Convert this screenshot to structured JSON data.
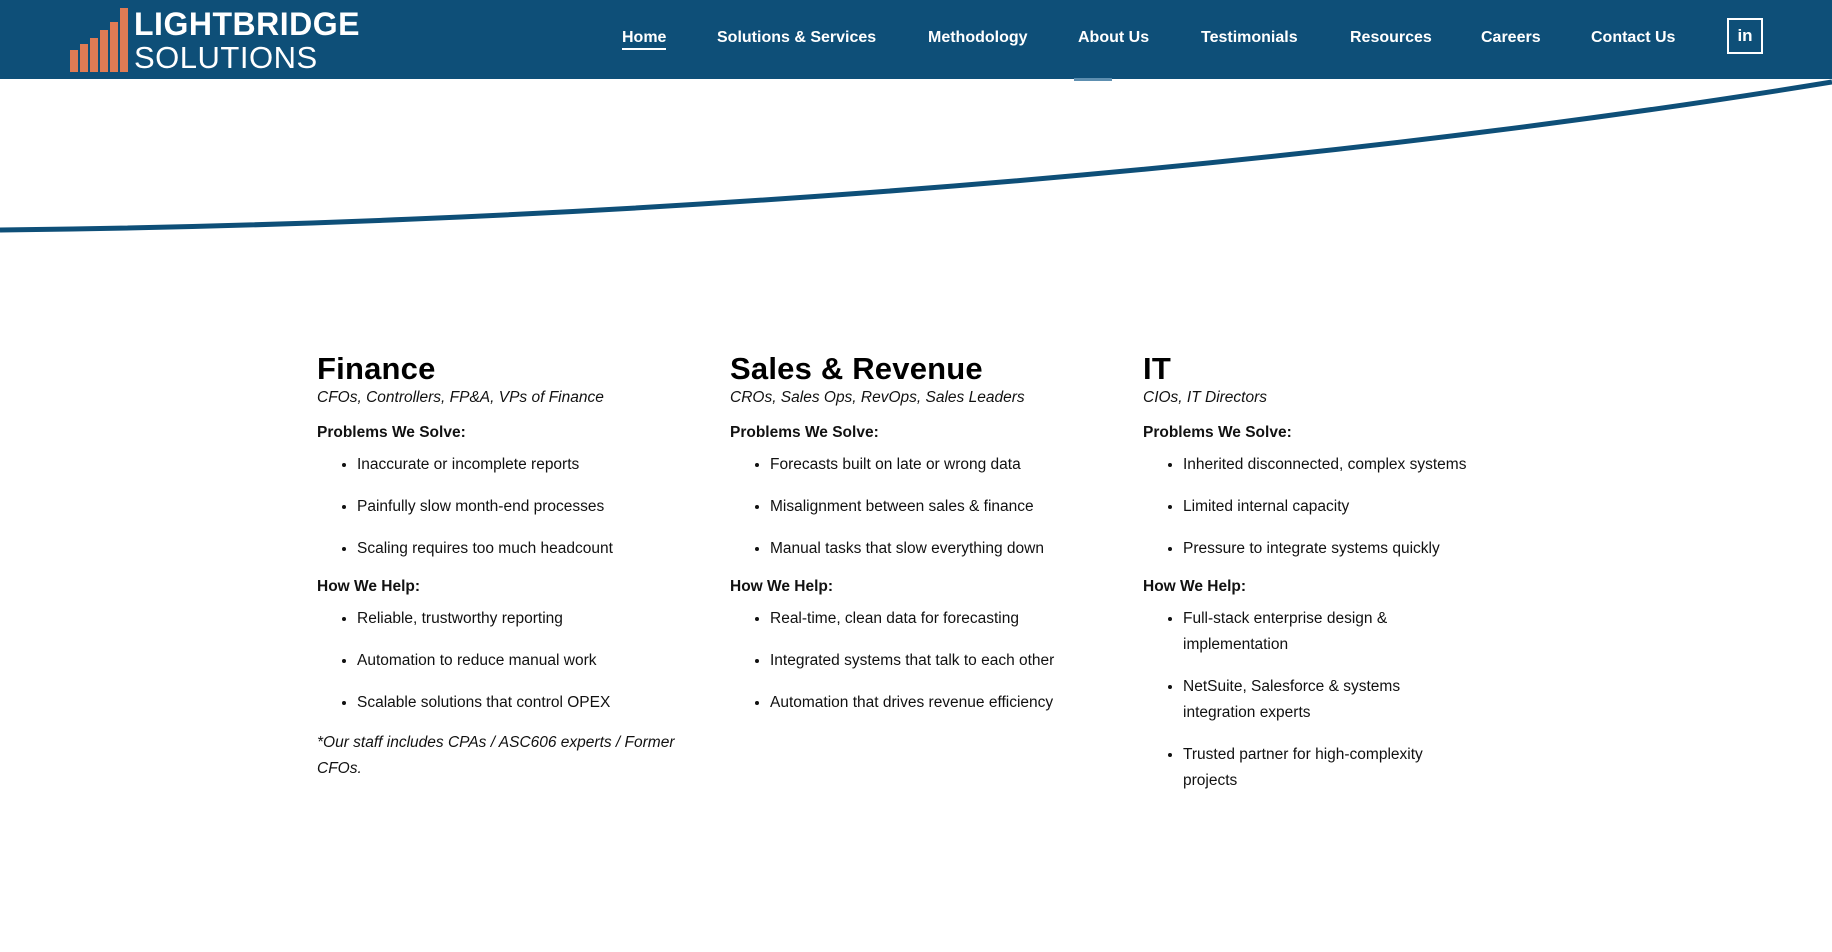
{
  "brand": {
    "name_top": "LIGHTBRIDGE",
    "name_bottom": "SOLUTIONS",
    "bar_color": "#e07b54",
    "header_color": "#0e4f78"
  },
  "nav": {
    "items": [
      {
        "label": "Home",
        "active": true
      },
      {
        "label": "Solutions & Services"
      },
      {
        "label": "Methodology"
      },
      {
        "label": "About Us"
      },
      {
        "label": "Testimonials"
      },
      {
        "label": "Resources"
      },
      {
        "label": "Careers"
      },
      {
        "label": "Contact Us"
      }
    ],
    "linkedin_label": "in",
    "linkedin_icon": "linkedin-icon"
  },
  "columns": [
    {
      "title": "Finance",
      "subtitle": "CFOs, Controllers, FP&A, VPs of Finance",
      "problems_label": "Problems We Solve:",
      "problems": [
        "Inaccurate or incomplete reports",
        "Painfully slow month-end processes",
        "Scaling requires too much headcount"
      ],
      "help_label": "How We Help:",
      "help": [
        "Reliable, trustworthy reporting",
        "Automation to reduce manual work",
        "Scalable solutions that control OPEX"
      ],
      "note": "*Our staff includes CPAs / ASC606 experts / Former CFOs."
    },
    {
      "title": "Sales & Revenue",
      "subtitle": "CROs, Sales Ops, RevOps, Sales Leaders",
      "problems_label": "Problems We Solve:",
      "problems": [
        "Forecasts built on late or wrong data",
        "Misalignment between sales & finance",
        "Manual tasks that slow everything down"
      ],
      "help_label": "How We Help:",
      "help": [
        "Real-time, clean data for forecasting",
        "Integrated systems that talk to each other",
        "Automation that drives revenue efficiency"
      ]
    },
    {
      "title": "IT",
      "subtitle": "CIOs, IT Directors",
      "problems_label": "Problems We Solve:",
      "problems": [
        "Inherited disconnected, complex systems",
        "Limited internal capacity",
        "Pressure to integrate systems quickly"
      ],
      "help_label": "How We Help:",
      "help": [
        "Full-stack enterprise design & implementation",
        "NetSuite, Salesforce & systems integration experts",
        "Trusted partner for high-complexity projects"
      ]
    }
  ]
}
